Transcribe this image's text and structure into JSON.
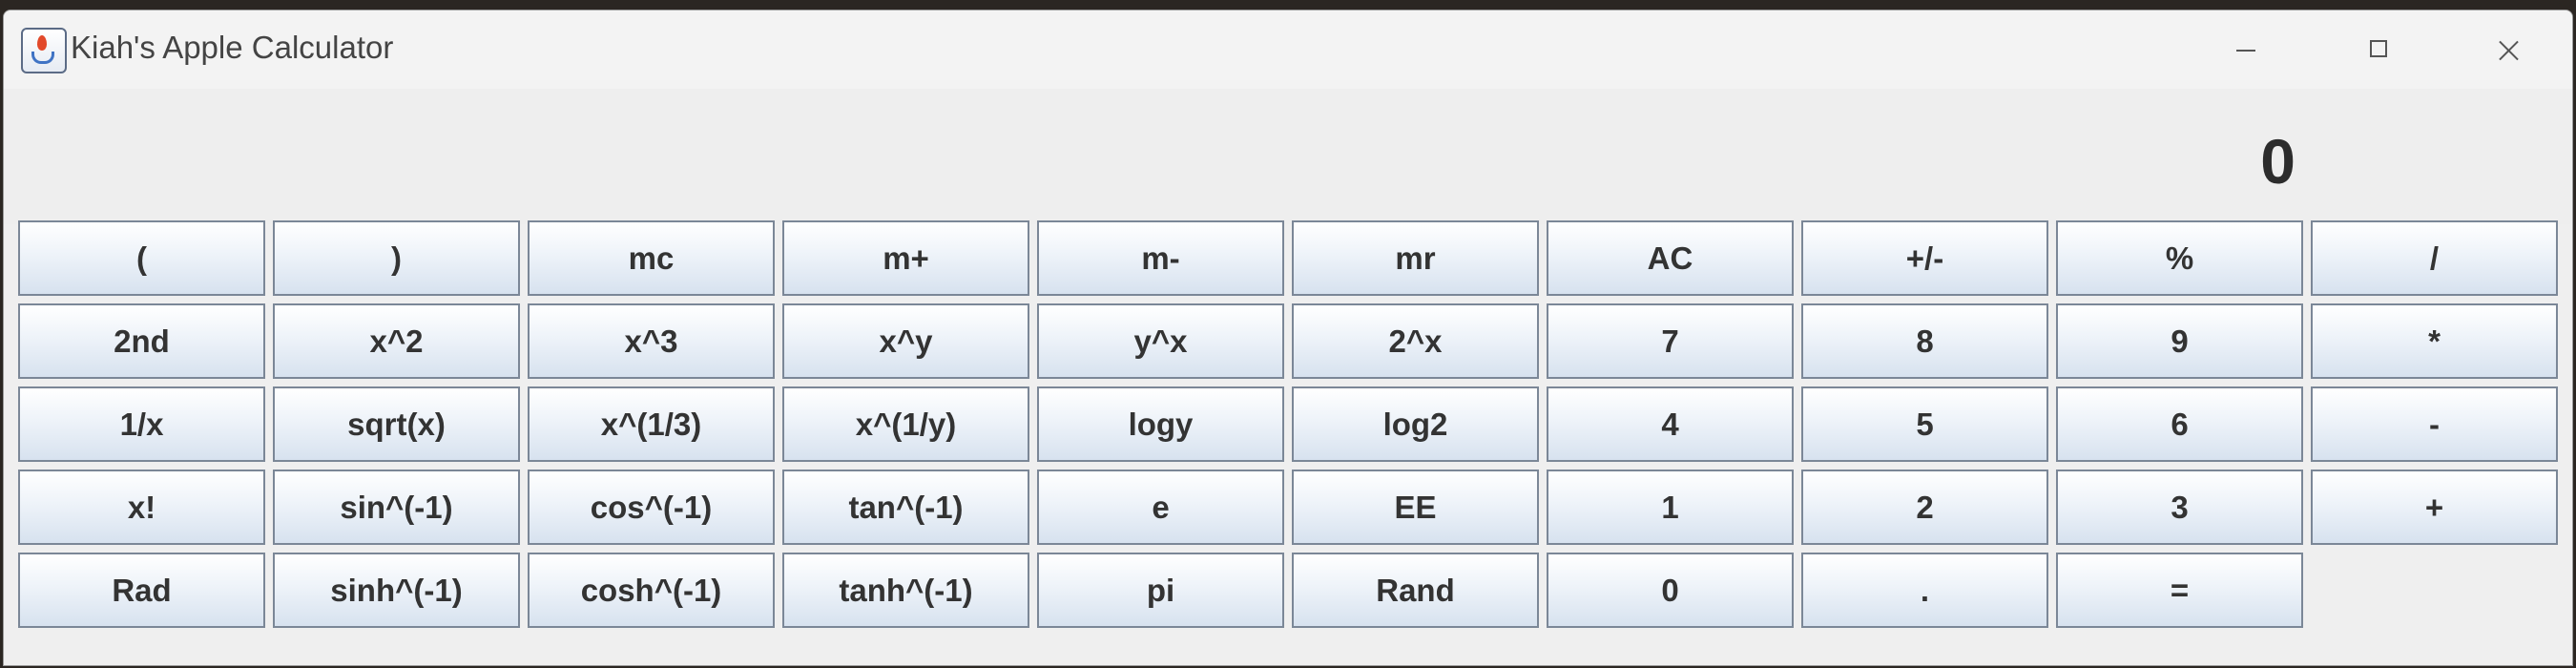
{
  "window": {
    "title": "Kiah's Apple Calculator"
  },
  "display": {
    "value": "0"
  },
  "keypad": {
    "rows": [
      [
        "(",
        ")",
        "mc",
        "m+",
        "m-",
        "mr",
        "AC",
        "+/-",
        "%",
        "/"
      ],
      [
        "2nd",
        "x^2",
        "x^3",
        "x^y",
        "y^x",
        "2^x",
        "7",
        "8",
        "9",
        "*"
      ],
      [
        "1/x",
        "sqrt(x)",
        "x^(1/3)",
        "x^(1/y)",
        "logy",
        "log2",
        "4",
        "5",
        "6",
        "-"
      ],
      [
        "x!",
        "sin^(-1)",
        "cos^(-1)",
        "tan^(-1)",
        "e",
        "EE",
        "1",
        "2",
        "3",
        "+"
      ],
      [
        "Rad",
        "sinh^(-1)",
        "cosh^(-1)",
        "tanh^(-1)",
        "pi",
        "Rand",
        "0",
        ".",
        "="
      ]
    ]
  }
}
